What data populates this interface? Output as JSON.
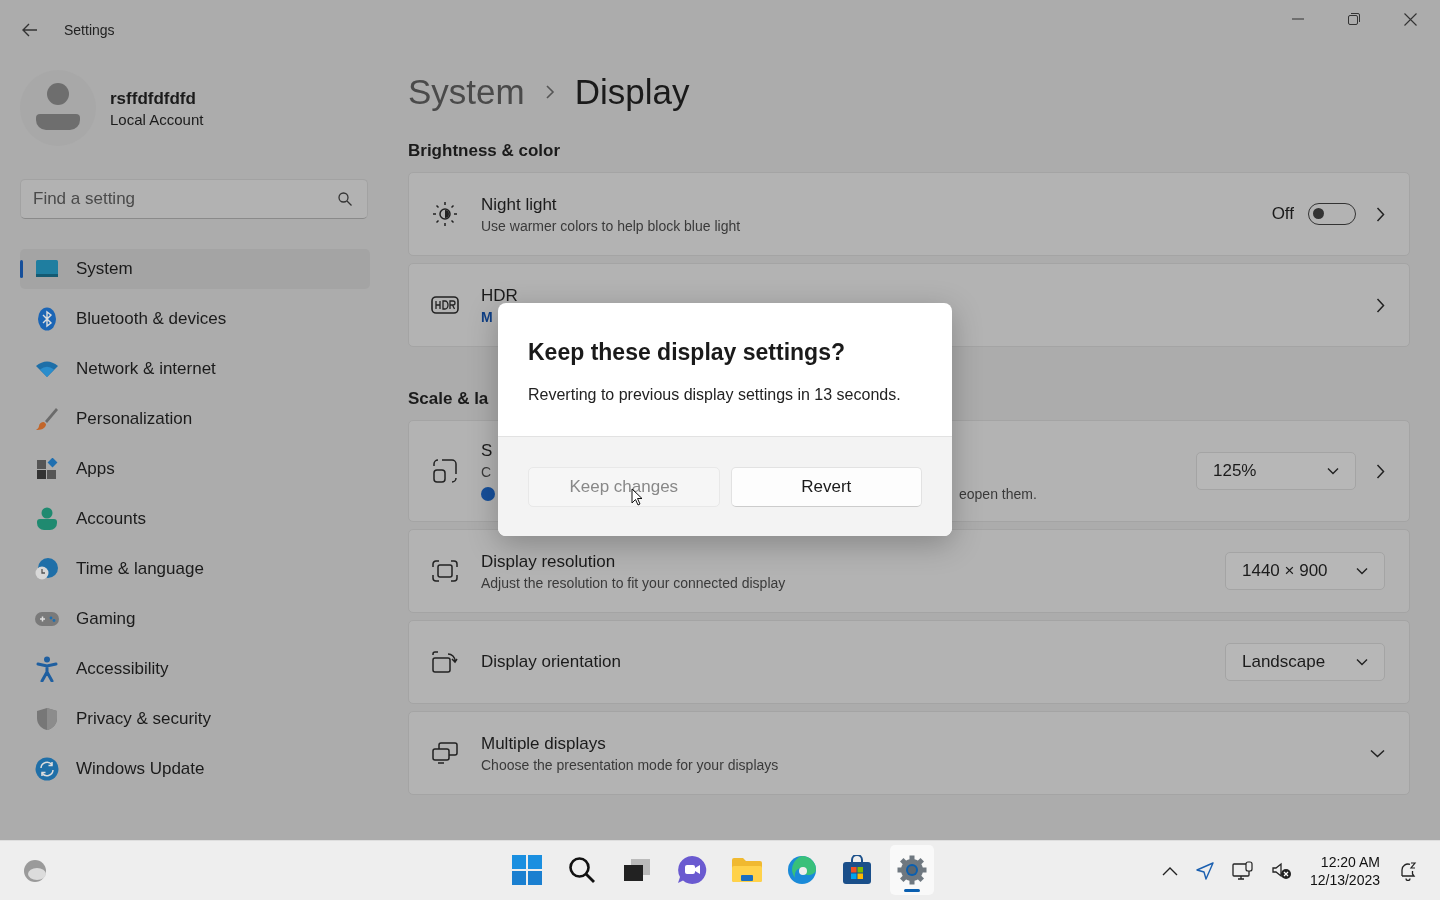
{
  "window": {
    "title": "Settings"
  },
  "user": {
    "name": "rsffdfdfdfd",
    "account_type": "Local Account"
  },
  "search": {
    "placeholder": "Find a setting"
  },
  "sidebar": {
    "items": [
      {
        "label": "System",
        "selected": true
      },
      {
        "label": "Bluetooth & devices",
        "selected": false
      },
      {
        "label": "Network & internet",
        "selected": false
      },
      {
        "label": "Personalization",
        "selected": false
      },
      {
        "label": "Apps",
        "selected": false
      },
      {
        "label": "Accounts",
        "selected": false
      },
      {
        "label": "Time & language",
        "selected": false
      },
      {
        "label": "Gaming",
        "selected": false
      },
      {
        "label": "Accessibility",
        "selected": false
      },
      {
        "label": "Privacy & security",
        "selected": false
      },
      {
        "label": "Windows Update",
        "selected": false
      }
    ]
  },
  "breadcrumb": {
    "parent": "System",
    "current": "Display"
  },
  "sections": [
    {
      "heading": "Brightness & color",
      "cards": [
        {
          "kind": "toggle",
          "title": "Night light",
          "description": "Use warmer colors to help block blue light",
          "state_label": "Off",
          "on": false
        },
        {
          "kind": "link",
          "title": "HDR",
          "link": "M"
        }
      ]
    },
    {
      "heading": "Scale & la",
      "cards": [
        {
          "kind": "scale",
          "title": "S",
          "description": "C",
          "note": "eopen them.",
          "value": "125%"
        },
        {
          "kind": "dropdown",
          "title": "Display resolution",
          "description": "Adjust the resolution to fit your connected display",
          "value": "1440 × 900"
        },
        {
          "kind": "dropdown",
          "title": "Display orientation",
          "value": "Landscape"
        },
        {
          "kind": "expander",
          "title": "Multiple displays",
          "description": "Choose the presentation mode for your displays",
          "expanded": false
        }
      ]
    }
  ],
  "dialog": {
    "title": "Keep these display settings?",
    "message": "Reverting to previous display settings in 13 seconds.",
    "buttons": [
      {
        "label": "Keep changes",
        "disabled": true
      },
      {
        "label": "Revert",
        "disabled": false
      }
    ]
  },
  "taskbar": {
    "apps": [
      {
        "running": false
      },
      {
        "running": false
      },
      {
        "running": false
      },
      {
        "running": false
      },
      {
        "running": false
      },
      {
        "running": false
      },
      {
        "running": false
      },
      {
        "running": true
      }
    ],
    "time": "12:20 AM",
    "date": "12/13/2023"
  }
}
